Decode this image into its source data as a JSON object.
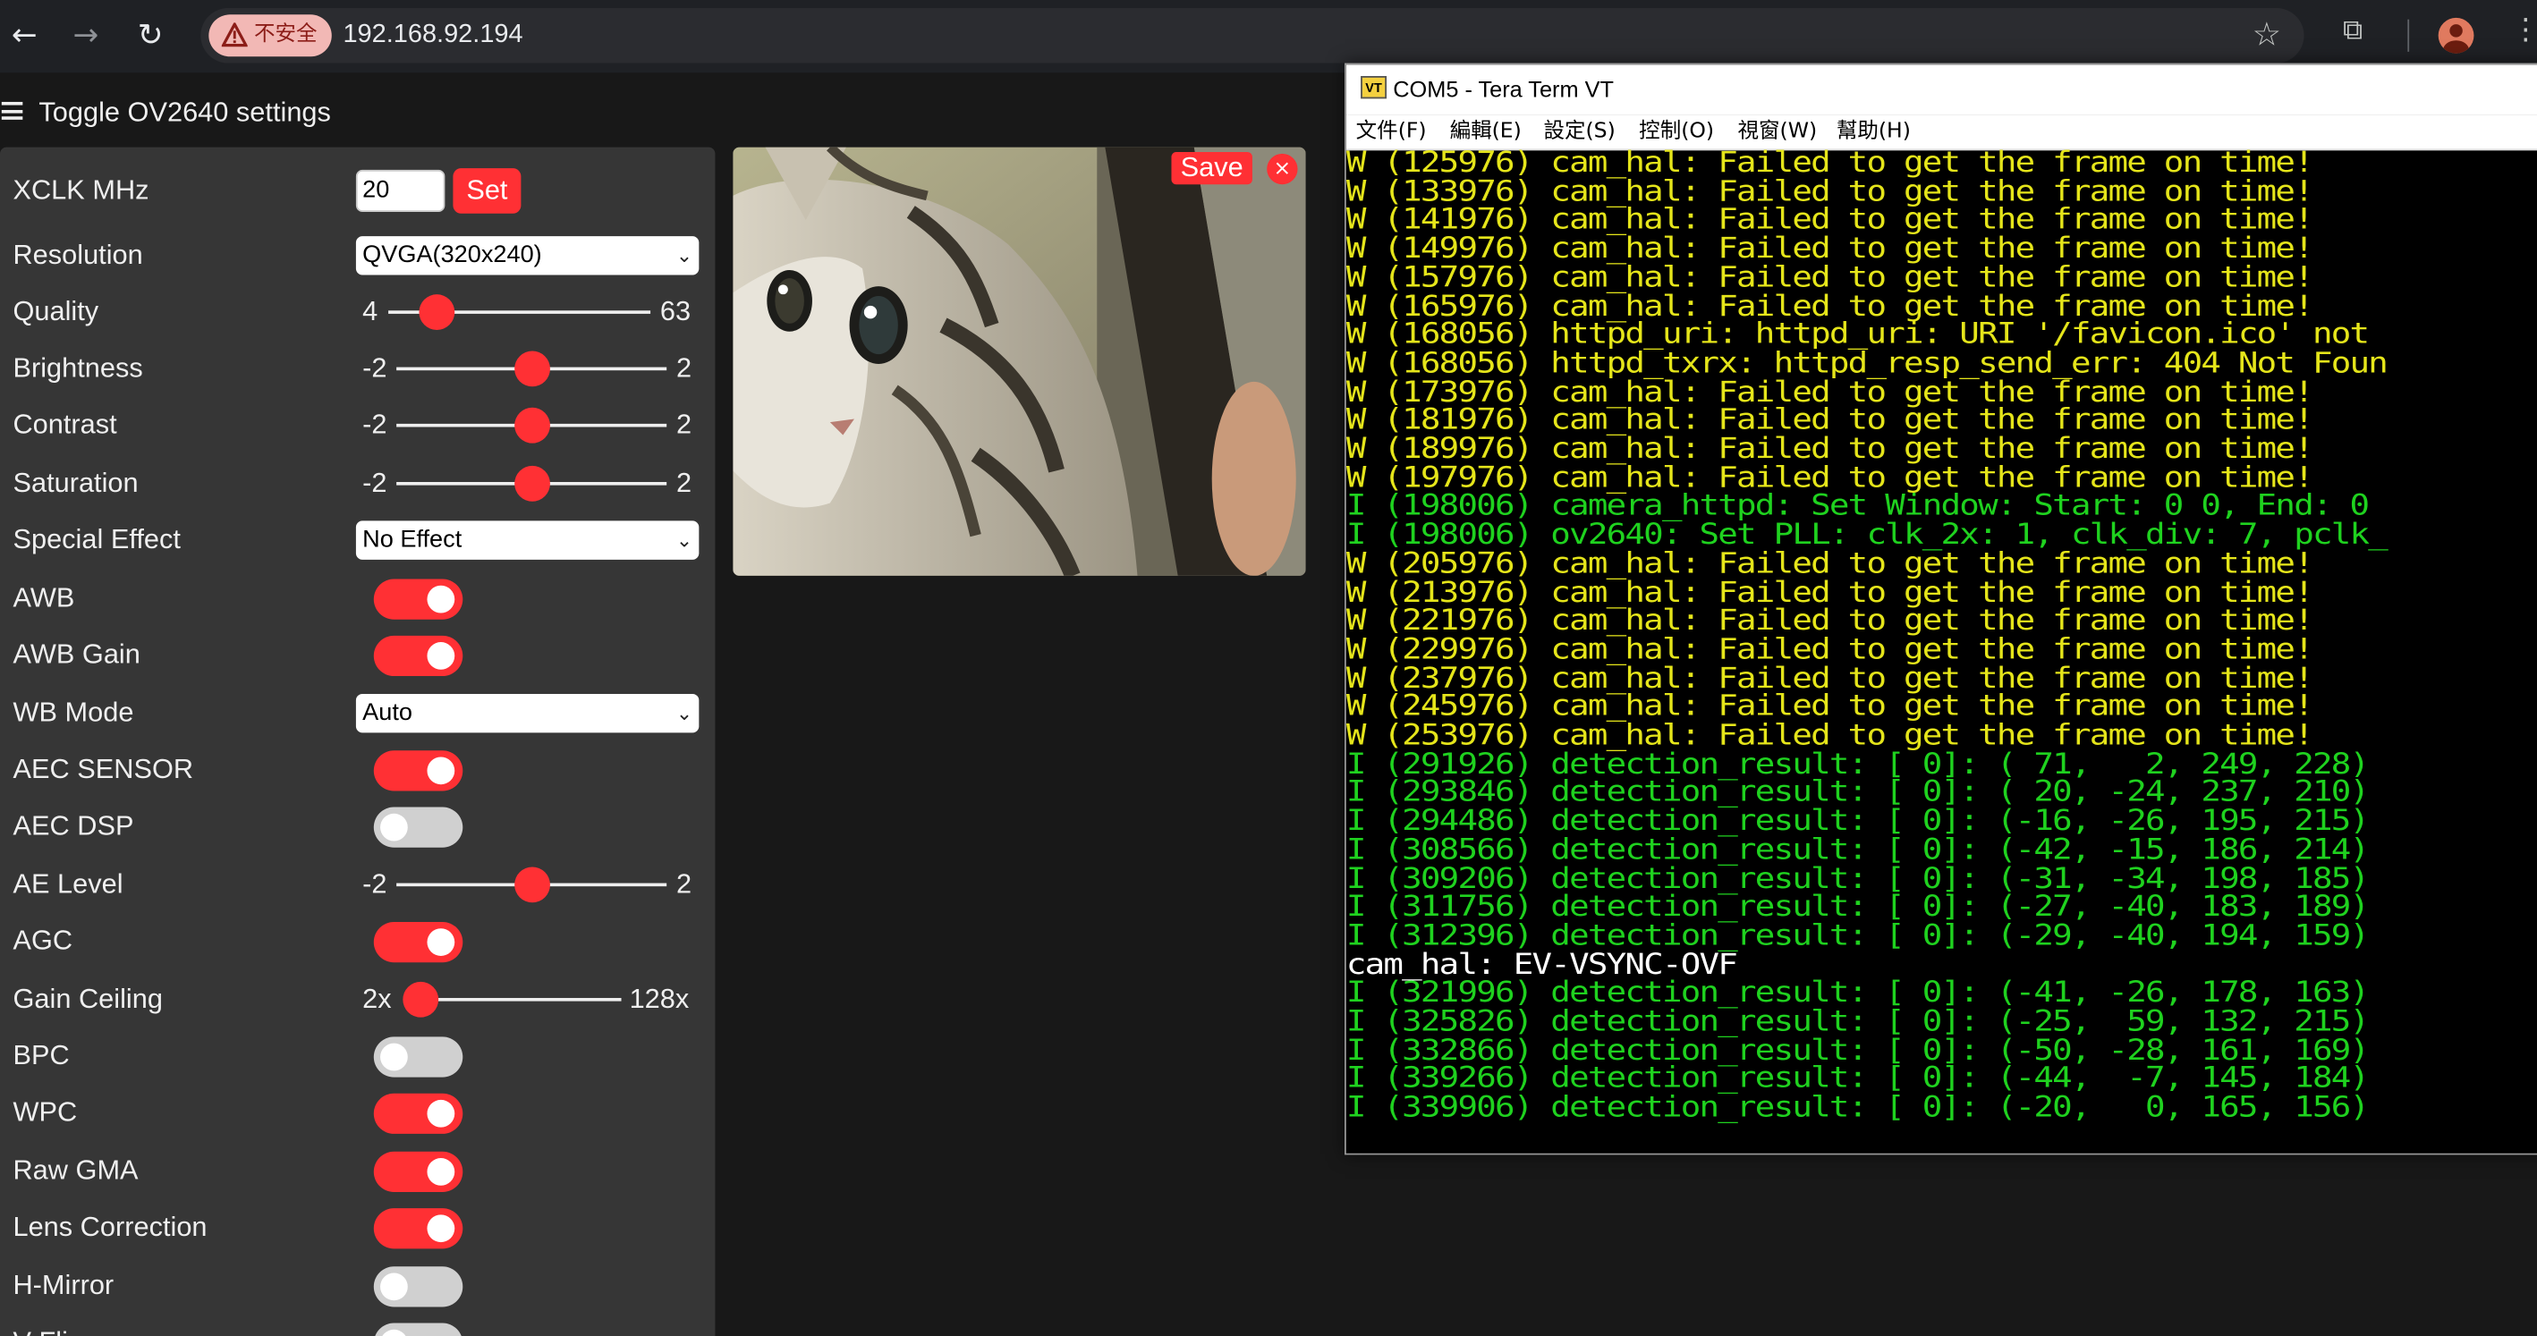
{
  "browser": {
    "security_label": "不安全",
    "url": "192.168.92.194"
  },
  "page": {
    "toggle_label": "Toggle OV2640 settings",
    "xclk": {
      "label": "XCLK MHz",
      "value": "20",
      "button": "Set"
    },
    "resolution": {
      "label": "Resolution",
      "value": "QVGA(320x240)"
    },
    "quality": {
      "label": "Quality",
      "min": "4",
      "max": "63",
      "value": 10
    },
    "brightness": {
      "label": "Brightness",
      "min": "-2",
      "max": "2",
      "value": 0
    },
    "contrast": {
      "label": "Contrast",
      "min": "-2",
      "max": "2",
      "value": 0
    },
    "saturation": {
      "label": "Saturation",
      "min": "-2",
      "max": "2",
      "value": 0
    },
    "special_effect": {
      "label": "Special Effect",
      "value": "No Effect"
    },
    "awb": {
      "label": "AWB",
      "on": true
    },
    "awb_gain": {
      "label": "AWB Gain",
      "on": true
    },
    "wb_mode": {
      "label": "WB Mode",
      "value": "Auto"
    },
    "aec_sensor": {
      "label": "AEC SENSOR",
      "on": true
    },
    "aec_dsp": {
      "label": "AEC DSP",
      "on": false
    },
    "ae_level": {
      "label": "AE Level",
      "min": "-2",
      "max": "2",
      "value": 0
    },
    "agc": {
      "label": "AGC",
      "on": true
    },
    "gain_ceiling": {
      "label": "Gain Ceiling",
      "min": "2x",
      "max": "128x",
      "value": 0
    },
    "bpc": {
      "label": "BPC",
      "on": false
    },
    "wpc": {
      "label": "WPC",
      "on": true
    },
    "raw_gma": {
      "label": "Raw GMA",
      "on": true
    },
    "lens_correction": {
      "label": "Lens Correction",
      "on": true
    },
    "h_mirror": {
      "label": "H-Mirror",
      "on": false
    },
    "v_flip": {
      "label": "V-Flip",
      "on": false
    },
    "stream": {
      "save_label": "Save",
      "close_label": "×"
    }
  },
  "teraterm": {
    "title": "COM5 - Tera Term VT",
    "menu": [
      "文件(F)",
      "編輯(E)",
      "設定(S)",
      "控制(O)",
      "視窗(W)",
      "幫助(H)"
    ],
    "lines": [
      {
        "level": "W",
        "text": "W (125976) cam_hal: Failed to get the frame on time!"
      },
      {
        "level": "W",
        "text": "W (133976) cam_hal: Failed to get the frame on time!"
      },
      {
        "level": "W",
        "text": "W (141976) cam_hal: Failed to get the frame on time!"
      },
      {
        "level": "W",
        "text": "W (149976) cam_hal: Failed to get the frame on time!"
      },
      {
        "level": "W",
        "text": "W (157976) cam_hal: Failed to get the frame on time!"
      },
      {
        "level": "W",
        "text": "W (165976) cam_hal: Failed to get the frame on time!"
      },
      {
        "level": "W",
        "text": "W (168056) httpd_uri: httpd_uri: URI '/favicon.ico' not"
      },
      {
        "level": "W",
        "text": "W (168056) httpd_txrx: httpd_resp_send_err: 404 Not Foun"
      },
      {
        "level": "W",
        "text": "W (173976) cam_hal: Failed to get the frame on time!"
      },
      {
        "level": "W",
        "text": "W (181976) cam_hal: Failed to get the frame on time!"
      },
      {
        "level": "W",
        "text": "W (189976) cam_hal: Failed to get the frame on time!"
      },
      {
        "level": "W",
        "text": "W (197976) cam_hal: Failed to get the frame on time!"
      },
      {
        "level": "I",
        "text": "I (198006) camera_httpd: Set Window: Start: 0 0, End: 0"
      },
      {
        "level": "I",
        "text": "I (198006) ov2640: Set PLL: clk_2x: 1, clk_div: 7, pclk_"
      },
      {
        "level": "W",
        "text": "W (205976) cam_hal: Failed to get the frame on time!"
      },
      {
        "level": "W",
        "text": "W (213976) cam_hal: Failed to get the frame on time!"
      },
      {
        "level": "W",
        "text": "W (221976) cam_hal: Failed to get the frame on time!"
      },
      {
        "level": "W",
        "text": "W (229976) cam_hal: Failed to get the frame on time!"
      },
      {
        "level": "W",
        "text": "W (237976) cam_hal: Failed to get the frame on time!"
      },
      {
        "level": "W",
        "text": "W (245976) cam_hal: Failed to get the frame on time!"
      },
      {
        "level": "W",
        "text": "W (253976) cam_hal: Failed to get the frame on time!"
      },
      {
        "level": "I",
        "text": "I (291926) detection_result: [ 0]: ( 71,   2, 249, 228)"
      },
      {
        "level": "I",
        "text": "I (293846) detection_result: [ 0]: ( 20, -24, 237, 210)"
      },
      {
        "level": "I",
        "text": "I (294486) detection_result: [ 0]: (-16, -26, 195, 215)"
      },
      {
        "level": "I",
        "text": "I (308566) detection_result: [ 0]: (-42, -15, 186, 214)"
      },
      {
        "level": "I",
        "text": "I (309206) detection_result: [ 0]: (-31, -34, 198, 185)"
      },
      {
        "level": "I",
        "text": "I (311756) detection_result: [ 0]: (-27, -40, 183, 189)"
      },
      {
        "level": "I",
        "text": "I (312396) detection_result: [ 0]: (-29, -40, 194, 159)"
      },
      {
        "level": "plain",
        "text": "cam_hal: EV-VSYNC-OVF"
      },
      {
        "level": "I",
        "text": "I (321996) detection_result: [ 0]: (-41, -26, 178, 163)"
      },
      {
        "level": "I",
        "text": "I (325826) detection_result: [ 0]: (-25,  59, 132, 215)"
      },
      {
        "level": "I",
        "text": "I (332866) detection_result: [ 0]: (-50, -28, 161, 169)"
      },
      {
        "level": "I",
        "text": "I (339266) detection_result: [ 0]: (-44,  -7, 145, 184)"
      },
      {
        "level": "I",
        "text": "I (339906) detection_result: [ 0]: (-20,   0, 165, 156)"
      }
    ]
  }
}
